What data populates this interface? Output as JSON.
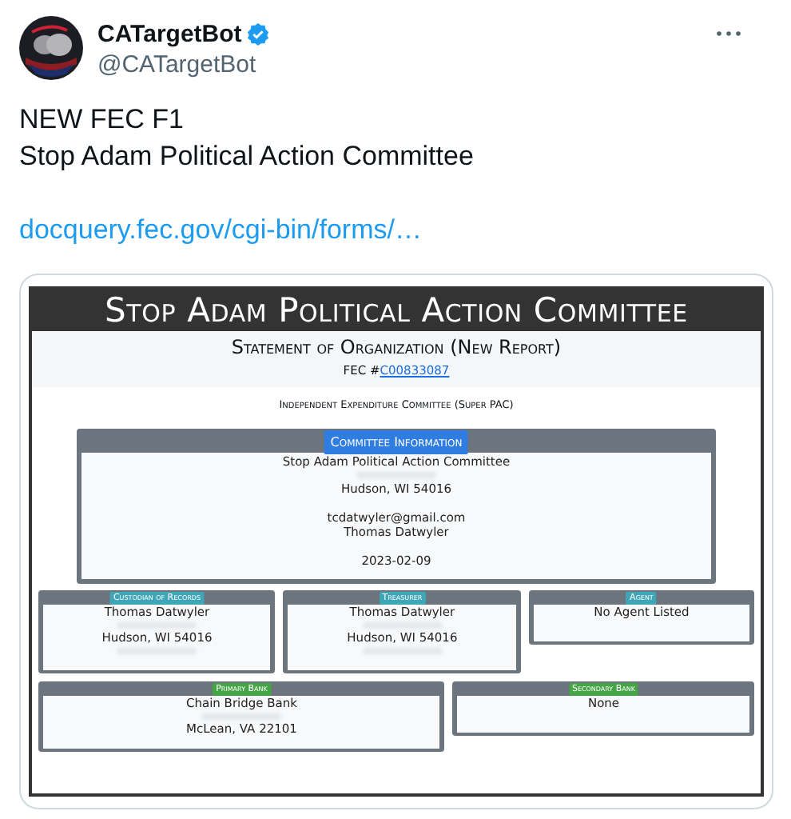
{
  "author": {
    "name": "CATargetBot",
    "verified": true,
    "handle": "@CATargetBot"
  },
  "tweet": {
    "lines": [
      "NEW FEC F1",
      "Stop Adam Political Action Committee"
    ],
    "link": "docquery.fec.gov/cgi-bin/forms/…"
  },
  "document": {
    "title": "Stop Adam Political Action Committee",
    "subtitle": "Statement of Organization (New Report)",
    "fec_label": "FEC #",
    "fec_id": "C00833087",
    "committee_type": "Independent Expenditure Committee (Super PAC)",
    "main_panel": {
      "label": "Committee Information",
      "color": "#2f7de1",
      "lines": [
        {
          "kind": "text",
          "text": "Stop Adam Political Action Committee"
        },
        {
          "kind": "redacted"
        },
        {
          "kind": "text",
          "text": "Hudson, WI 54016"
        },
        {
          "kind": "blank"
        },
        {
          "kind": "text",
          "text": "tcdatwyler@gmail.com"
        },
        {
          "kind": "text",
          "text": "Thomas Datwyler"
        },
        {
          "kind": "blank"
        },
        {
          "kind": "text",
          "text": "2023-02-09"
        }
      ]
    },
    "row_1": [
      {
        "label": "Custodian of Records",
        "color": "#3fa6b8",
        "lines": [
          {
            "kind": "text",
            "text": "Thomas Datwyler"
          },
          {
            "kind": "redacted"
          },
          {
            "kind": "text",
            "text": "Hudson, WI 54016"
          },
          {
            "kind": "redacted"
          }
        ]
      },
      {
        "label": "Treasurer",
        "color": "#3fa6b8",
        "lines": [
          {
            "kind": "text",
            "text": "Thomas Datwyler"
          },
          {
            "kind": "redacted"
          },
          {
            "kind": "text",
            "text": "Hudson, WI 54016"
          },
          {
            "kind": "redacted"
          }
        ]
      },
      {
        "label": "Agent",
        "color": "#3fa6b8",
        "lines": [
          {
            "kind": "text",
            "text": "No Agent Listed"
          }
        ]
      }
    ],
    "row_2": [
      {
        "label": "Primary Bank",
        "color": "#45a445",
        "lines": [
          {
            "kind": "text",
            "text": "Chain Bridge Bank"
          },
          {
            "kind": "redacted"
          },
          {
            "kind": "text",
            "text": "McLean, VA 22101"
          }
        ]
      },
      {
        "label": "Secondary Bank",
        "color": "#45a445",
        "lines": [
          {
            "kind": "text",
            "text": "None"
          }
        ]
      }
    ]
  }
}
